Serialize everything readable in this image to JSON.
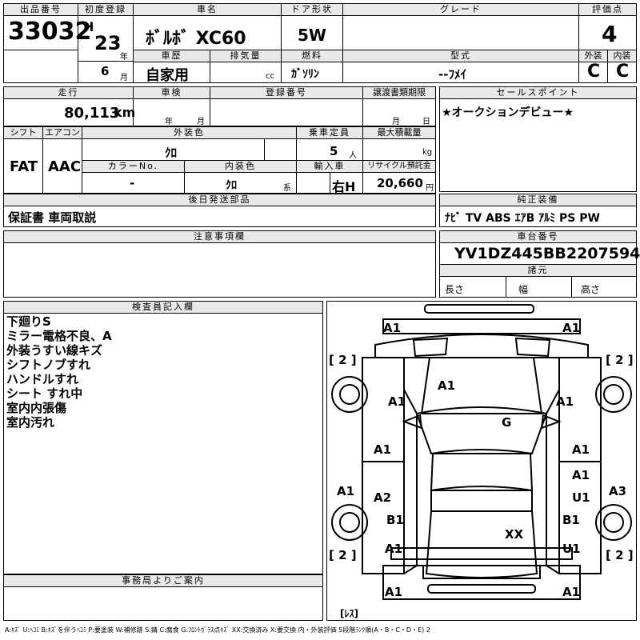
{
  "header": {
    "lot_label": "出品番号",
    "lot": "33032",
    "first_reg_label": "初度登録",
    "era": "H",
    "year": "23",
    "year_unit": "年",
    "month": "6",
    "month_unit": "月",
    "car_name_label": "車名",
    "car_name": "ﾎﾞﾙﾎﾞ XC60",
    "door_label": "ドア形状",
    "door": "5W",
    "grade_label": "グレード",
    "grade": "",
    "score_label": "評価点",
    "score": "4",
    "history_label": "車歴",
    "history": "自家用",
    "displacement_label": "排気量",
    "displacement": "",
    "displacement_unit": "cc",
    "fuel_label": "燃料",
    "fuel": "ｶﾞｿﾘﾝ",
    "model_label": "型式",
    "model": "--ﾌﾒｲ",
    "ext_label": "外装",
    "ext": "C",
    "int_label": "内装",
    "int": "C"
  },
  "row2": {
    "mileage_label": "走行",
    "mileage": "80,113",
    "mileage_unit": "km",
    "inspection_label": "車検",
    "insp_year_unit": "年",
    "insp_month_unit": "月",
    "reg_no_label": "登録番号",
    "reg_no": "",
    "transfer_label": "譲渡書類期限",
    "transfer_month_unit": "月",
    "transfer_day_unit": "日",
    "sales_point_label": "セールスポイント",
    "sales_point": "★オークションデビュー★"
  },
  "row3": {
    "shift_label": "シフト",
    "shift": "FAT",
    "ac_label": "エアコン",
    "ac": "AAC",
    "ext_color_label": "外装色",
    "ext_color": "ｸﾛ",
    "capacity_label": "乗車定員",
    "capacity": "5",
    "capacity_unit": "人",
    "max_load_label": "最大積載量",
    "max_load": "",
    "max_load_unit": "kg",
    "color_no_label": "カラーNo.",
    "color_no": "-",
    "int_color_label": "内装色",
    "int_color": "ｸﾛ",
    "int_color_unit": "系",
    "import_label": "輸入車",
    "steering": "右H",
    "recycle_label": "リサイクル預託金",
    "recycle": "20,660",
    "recycle_unit": "円"
  },
  "later_parts": {
    "label": "後日発送部品",
    "value": "保証書 車両取説"
  },
  "genuine": {
    "label": "純正装備",
    "value": "ﾅﾋﾞ TV ABS ｴｱB ｱﾙﾐ PS PW"
  },
  "caution": {
    "label": "注意事項欄",
    "value": ""
  },
  "vin": {
    "label": "車台番号",
    "value": "YV1DZ445BB2207594"
  },
  "specs": {
    "label": "諸元",
    "length": "長さ",
    "width": "幅",
    "height": "高さ"
  },
  "inspector": {
    "label": "検査員記入欄",
    "lines": [
      "下廻りS",
      "ミラー電格不良、A",
      "外装うすい線キズ",
      "シフトノブすれ",
      "ハンドルすれ",
      "シート すれ中",
      "室内内張傷",
      "室内汚れ"
    ]
  },
  "office": {
    "label": "事務局よりご案内",
    "value": ""
  },
  "legend": "A:ｷｽﾞ U:ﾍｺﾐ B:ｷｽﾞを伴うﾍｺﾐ P:要塗装 W:補修跡 S:錆 C:腐食 G:ﾌﾛﾝﾄｶﾞﾗｽ点ｷｽﾞ XX:交換済み X:要交換 内・外装評価 5段階ﾗﾝｸ順(A・B・C・D・E) 2",
  "diagram": {
    "marks": [
      "A1",
      "A1",
      "[ 2 ]",
      "[ 2 ]",
      "A1",
      "A1",
      "A1",
      "G",
      "A1",
      "A1",
      "A1",
      "A1",
      "A2",
      "U1",
      "A3",
      "B1",
      "B1",
      "XX",
      "A1",
      "U1",
      "[ 2 ]",
      "[ 2 ]",
      "A1",
      "A1",
      "[ﾚｽ]"
    ]
  }
}
